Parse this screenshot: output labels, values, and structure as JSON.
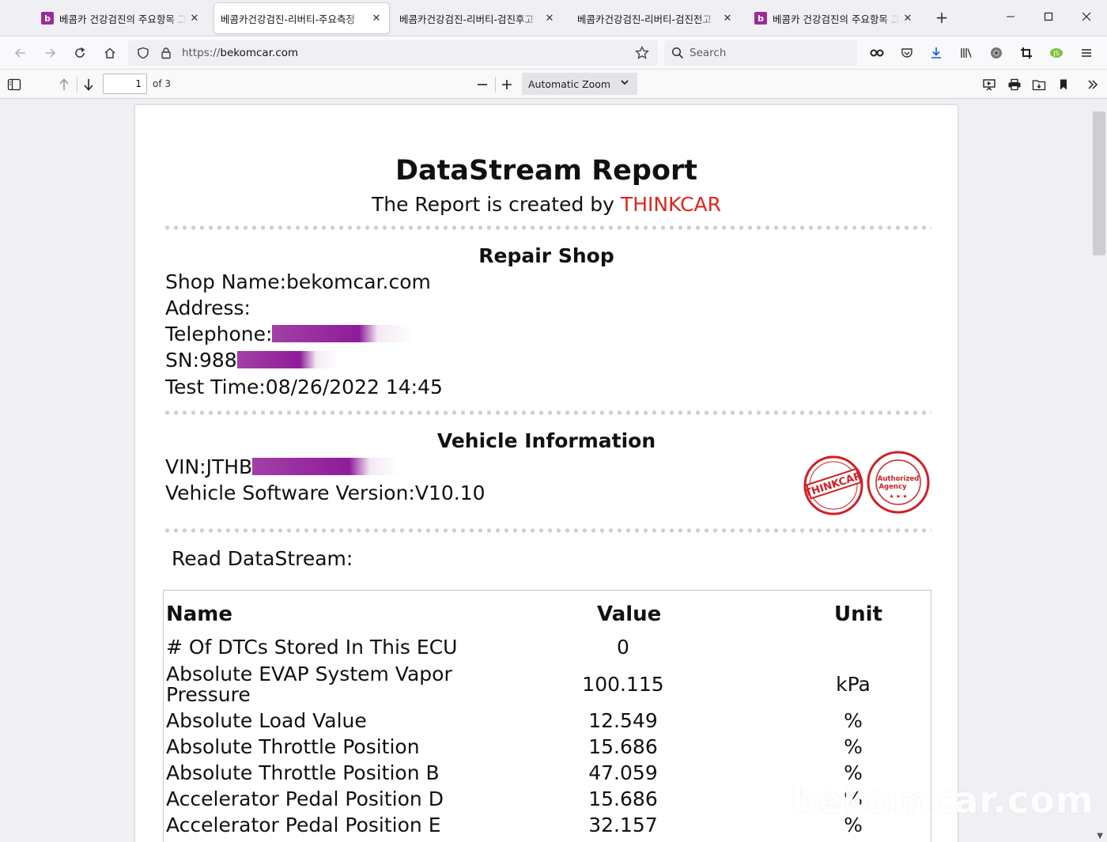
{
  "tabs": [
    {
      "label": "베콤카 건강검진의 주요항목 그",
      "favicon": "b",
      "active": false
    },
    {
      "label": "베콤카건강검진-리버티-주요측정",
      "favicon": "",
      "active": true
    },
    {
      "label": "베콤카건강검진-리버티-검진후고",
      "favicon": "",
      "active": false
    },
    {
      "label": "베콤카건강검진-리버티-검진전고",
      "favicon": "",
      "active": false
    },
    {
      "label": "베콤카 건강검진의 주요항목 그",
      "favicon": "b",
      "active": false
    }
  ],
  "nav": {
    "url_prefix": "https://",
    "url_host": "bekomcar.com",
    "search_placeholder": "Search"
  },
  "pdf_toolbar": {
    "page_number": "1",
    "page_count": "of 3",
    "zoom": "Automatic Zoom"
  },
  "report": {
    "title": "DataStream Report",
    "subtitle_prefix": "The Report is created by ",
    "subtitle_brand": "THINKCAR",
    "repair_shop_heading": "Repair Shop",
    "shop_name": "Shop Name:bekomcar.com",
    "address": "Address:",
    "telephone_label": "Telephone:",
    "sn_label": "SN:988",
    "test_time": "Test Time:08/26/2022 14:45",
    "vehicle_heading": "Vehicle Information",
    "vin_label": "VIN:JTHB",
    "software_version": "Vehicle Software Version:V10.10",
    "stamp_left": "THINKCAR",
    "stamp_right_line1": "Authorized",
    "stamp_right_line2": "Agency",
    "read_label": "Read DataStream:",
    "columns": {
      "name": "Name",
      "value": "Value",
      "unit": "Unit"
    },
    "rows": [
      {
        "name": "# Of DTCs Stored In This ECU",
        "name2": "",
        "value": "0",
        "unit": ""
      },
      {
        "name": "Absolute EVAP System Vapor",
        "name2": "Pressure",
        "value": "100.115",
        "unit": "kPa"
      },
      {
        "name": "Absolute Load Value",
        "name2": "",
        "value": "12.549",
        "unit": "%"
      },
      {
        "name": "Absolute Throttle Position",
        "name2": "",
        "value": "15.686",
        "unit": "%"
      },
      {
        "name": "Absolute Throttle Position B",
        "name2": "",
        "value": "47.059",
        "unit": "%"
      },
      {
        "name": "Accelerator Pedal Position D",
        "name2": "",
        "value": "15.686",
        "unit": "%"
      },
      {
        "name": "Accelerator Pedal Position E",
        "name2": "",
        "value": "32.157",
        "unit": "%"
      }
    ]
  },
  "watermark": "bekomcar.com",
  "colors": {
    "brand": "#e3231b",
    "favicon": "#9c2b95",
    "redaction": "#9c2b95",
    "stamp": "#d11f26"
  }
}
